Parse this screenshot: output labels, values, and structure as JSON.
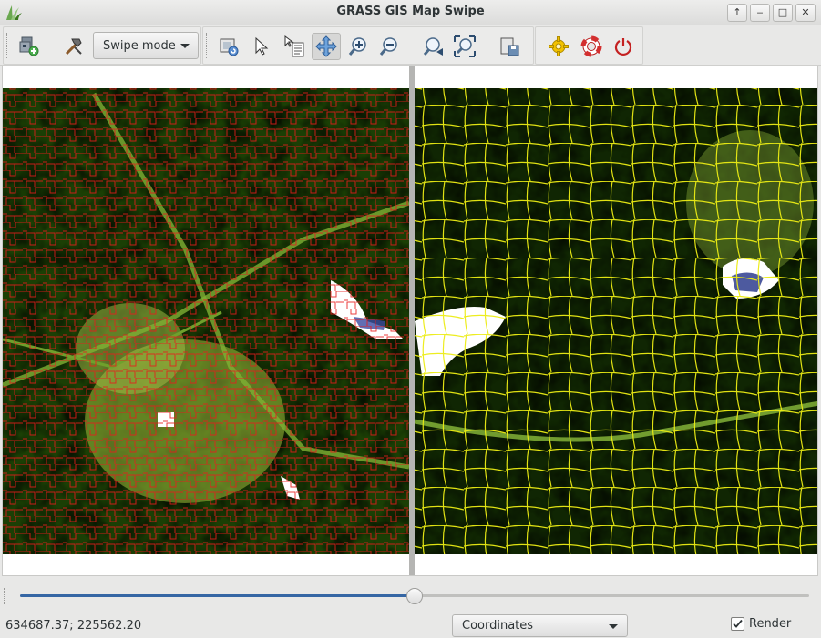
{
  "window": {
    "title": "GRASS GIS Map Swipe"
  },
  "window_controls": {
    "restore": "↑",
    "minimize": "‒",
    "maximize": "□",
    "close": "✕"
  },
  "toolbar": {
    "swipe_mode_label": "Swipe mode",
    "tools": [
      "add-map-layers-icon",
      "tools-hammer-icon",
      "render-map-icon",
      "pointer-icon",
      "query-icon",
      "pan-icon",
      "zoom-in-icon",
      "zoom-out-icon",
      "zoom-back-icon",
      "zoom-extent-icon",
      "save-image-icon",
      "settings-gear-icon",
      "help-lifebuoy-icon",
      "quit-power-icon"
    ]
  },
  "swipe": {
    "position": 0.5
  },
  "statusbar": {
    "coordinates": "634687.37; 225562.20",
    "display_mode": "Coordinates",
    "render_label": "Render",
    "render_checked": true
  },
  "colors": {
    "accent": "#3566a4",
    "left_boundaries": "#e81c1c",
    "right_boundaries": "#ecec14",
    "quit": "#c42121"
  }
}
